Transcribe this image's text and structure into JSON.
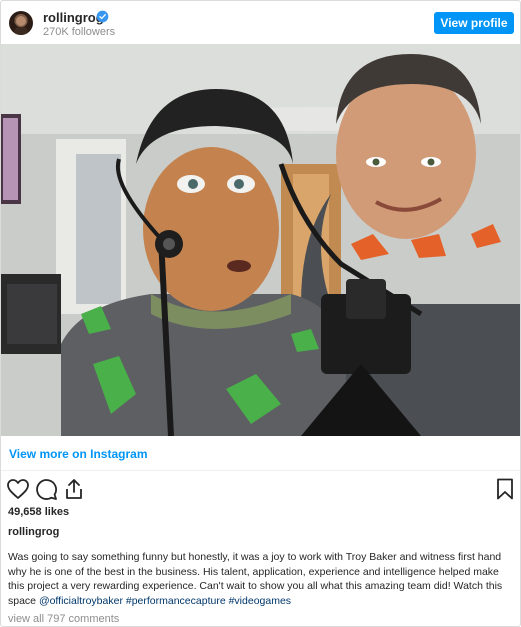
{
  "header": {
    "username": "rollingrog",
    "followers": "270K followers",
    "view_profile_label": "View profile"
  },
  "post": {
    "view_more_label": "View more on Instagram",
    "likes": "49,658 likes",
    "caption_user": "rollingrog",
    "caption_parts": [
      {
        "text": "Was going to say something funny but honestly, it was a joy to work with Troy Baker and witness first hand why he is one of the best in the business. His talent, application, experience and intelligence helped make this project a very rewarding experience. Can't wait to show you all what this amazing team did! Watch this space "
      },
      {
        "text": "@officialtroybaker",
        "tag": true
      },
      {
        "text": " "
      },
      {
        "text": "#performancecapture",
        "tag": true
      },
      {
        "text": " "
      },
      {
        "text": "#videogames",
        "tag": true
      }
    ],
    "comments_label": "view all 797 comments"
  },
  "icons": {
    "verified": "verified-badge-icon",
    "like": "heart-icon",
    "comment": "comment-icon",
    "share": "share-icon",
    "save": "bookmark-icon"
  },
  "colors": {
    "accent": "#0095f6",
    "verified": "#3897f0",
    "tag": "#00376b",
    "muted": "#8e8e8e"
  }
}
